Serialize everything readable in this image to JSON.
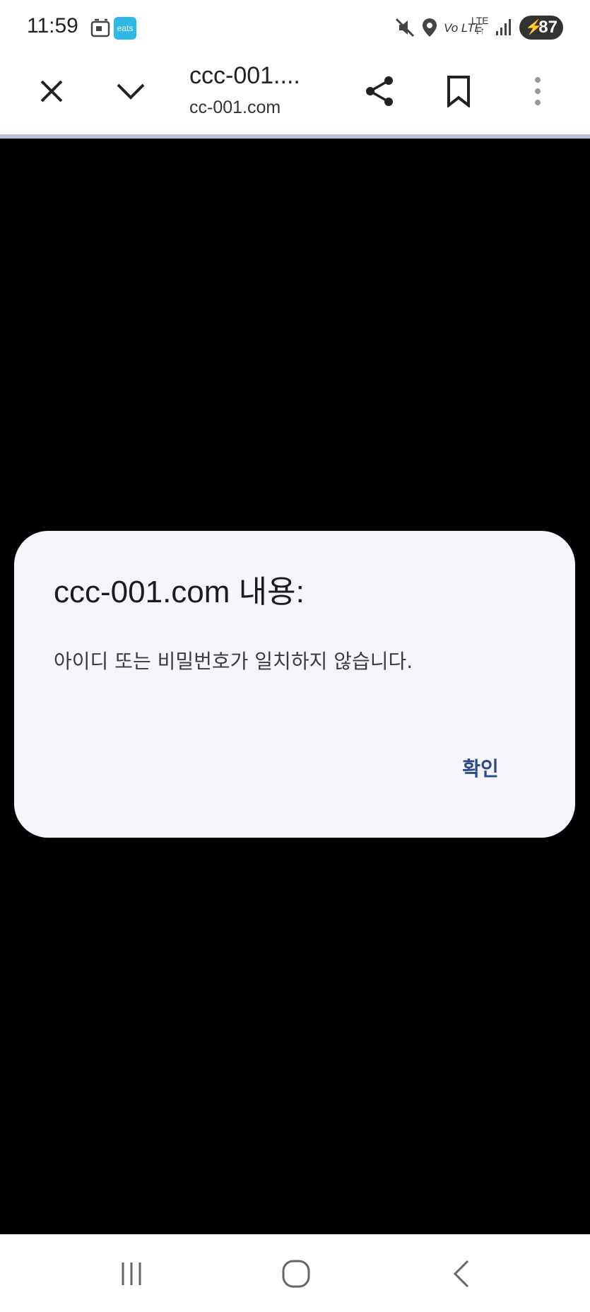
{
  "status_bar": {
    "time": "11:59",
    "app_badge": "eats",
    "volte": "Vo LTE",
    "lte_label": "LTE",
    "battery": "87"
  },
  "toolbar": {
    "page_title": "ccc-001....",
    "page_url": "cc-001.com",
    "close_icon": "close-icon",
    "collapse_icon": "chevron-down-icon",
    "share_icon": "share-icon",
    "bookmark_icon": "bookmark-icon",
    "menu_icon": "more-vert-icon"
  },
  "dialog": {
    "title": "ccc-001.com 내용:",
    "message": "아이디 또는 비밀번호가 일치하지 않습니다.",
    "ok_label": "확인"
  },
  "navbar": {
    "recents_icon": "recents-icon",
    "home_icon": "home-icon",
    "back_icon": "back-icon"
  },
  "colors": {
    "dialog_bg": "#f6f5fb",
    "button_text": "#2c4a8a",
    "battery_bg": "#333333",
    "eats_badge": "#2fb9e6",
    "toolbar_border": "#b7c0d8"
  }
}
